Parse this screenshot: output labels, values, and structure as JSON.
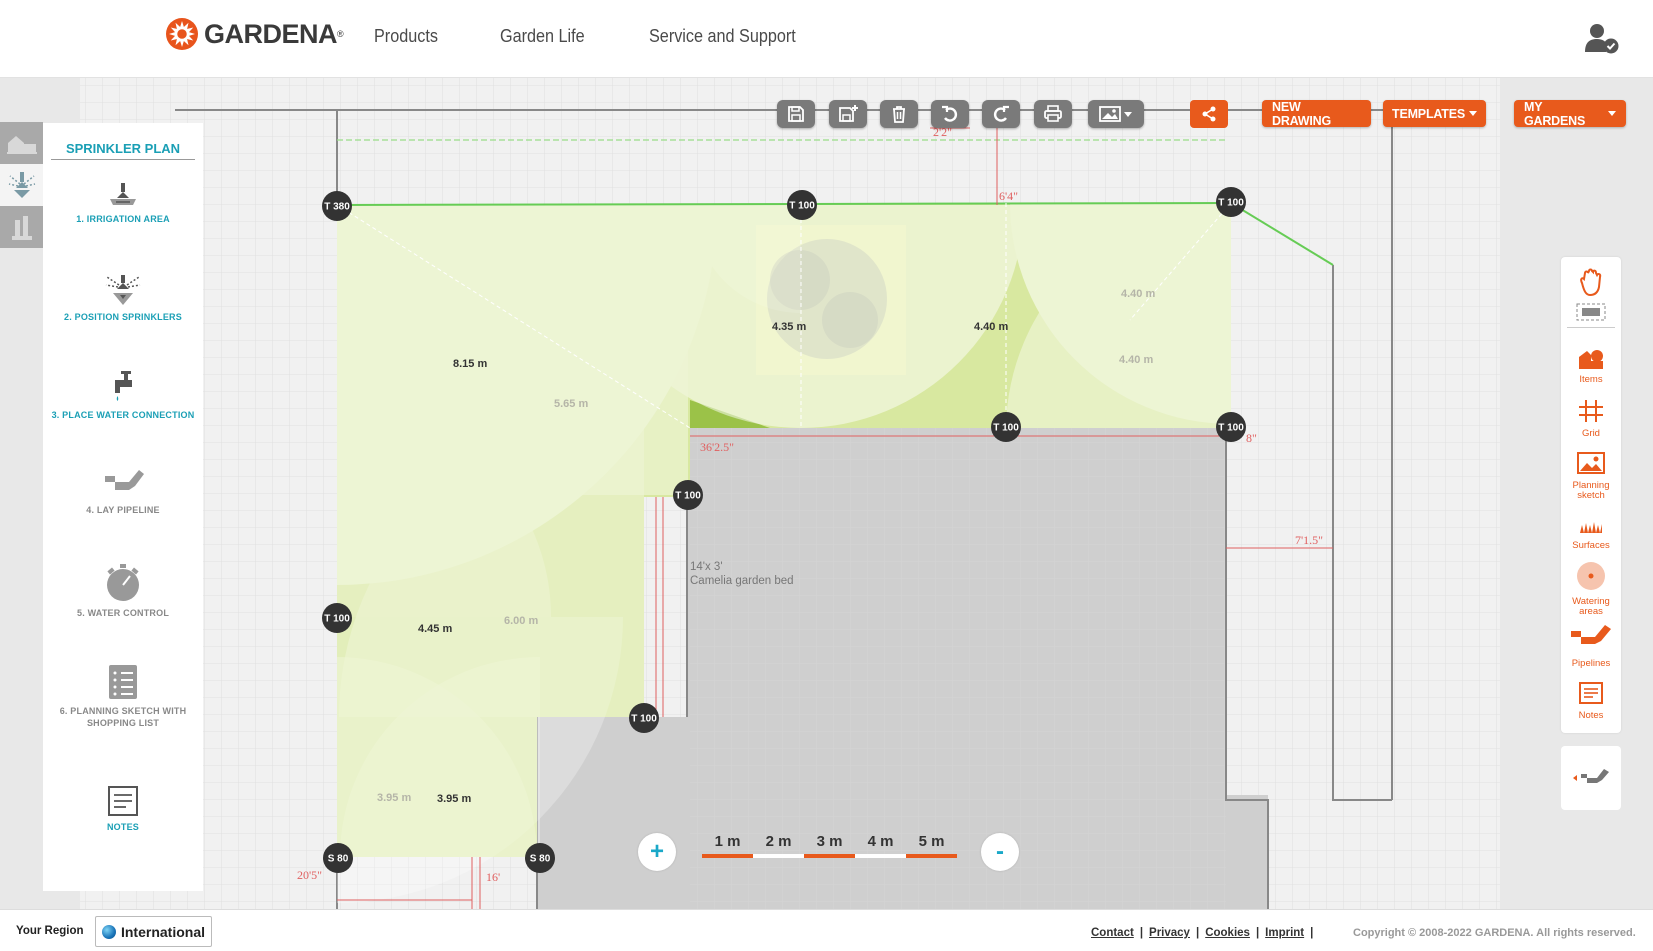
{
  "header": {
    "brand": "GARDENA",
    "nav": [
      "Products",
      "Garden Life",
      "Service and Support"
    ]
  },
  "toolbar": {
    "new_drawing": "NEW DRAWING",
    "templates": "TEMPLATES",
    "my_gardens": "MY GARDENS",
    "icons": [
      "save-icon",
      "save-as-icon",
      "trash-icon",
      "undo-icon",
      "redo-icon",
      "print-icon",
      "image-export-icon"
    ]
  },
  "left_panel": {
    "title": "SPRINKLER PLAN",
    "steps": [
      {
        "label": "1. IRRIGATION AREA",
        "active": true
      },
      {
        "label": "2. POSITION SPRINKLERS",
        "active": true
      },
      {
        "label": "3. PLACE WATER CONNECTION",
        "active": true
      },
      {
        "label": "4. LAY PIPELINE",
        "active": false
      },
      {
        "label": "5. WATER CONTROL",
        "active": false
      },
      {
        "label": "6. PLANNING SKETCH WITH SHOPPING LIST",
        "active": false
      },
      {
        "label": "NOTES",
        "active": true
      }
    ]
  },
  "right_panel": {
    "items": [
      "Items",
      "Grid",
      "Planning sketch",
      "Surfaces",
      "Watering areas",
      "Pipelines",
      "Notes"
    ]
  },
  "scale": {
    "labels": [
      "1 m",
      "2 m",
      "3 m",
      "4 m",
      "5 m"
    ],
    "zoom_in": "+",
    "zoom_out": "-"
  },
  "plan": {
    "sprinklers": [
      "T 380",
      "T 100",
      "T 100",
      "T 100",
      "T 100",
      "T 100",
      "T 100",
      "T 100",
      "S 80",
      "S 80"
    ],
    "distances": [
      "8.15 m",
      "5.65 m",
      "4.35 m",
      "4.40 m",
      "4.40 m",
      "4.40 m",
      "4.45 m",
      "6.00 m",
      "3.95 m",
      "3.95 m"
    ],
    "dimensions": [
      "2'2\"",
      "6'4\"",
      "36'2.5\"",
      "8\"",
      "7'1.5\"",
      "20'5\"",
      "16'"
    ],
    "bed_size": "14'x 3'",
    "bed_name": "Camelia garden bed",
    "colors": {
      "lawn": "#d8e8a0",
      "accent": "#e85a1c",
      "teal": "#1a9fb5"
    }
  },
  "footer": {
    "region_label": "Your Region",
    "region_value": "International",
    "links": [
      "Contact",
      "Privacy",
      "Cookies",
      "Imprint"
    ],
    "copyright": "Copyright © 2008-2022 GARDENA. All rights reserved."
  }
}
